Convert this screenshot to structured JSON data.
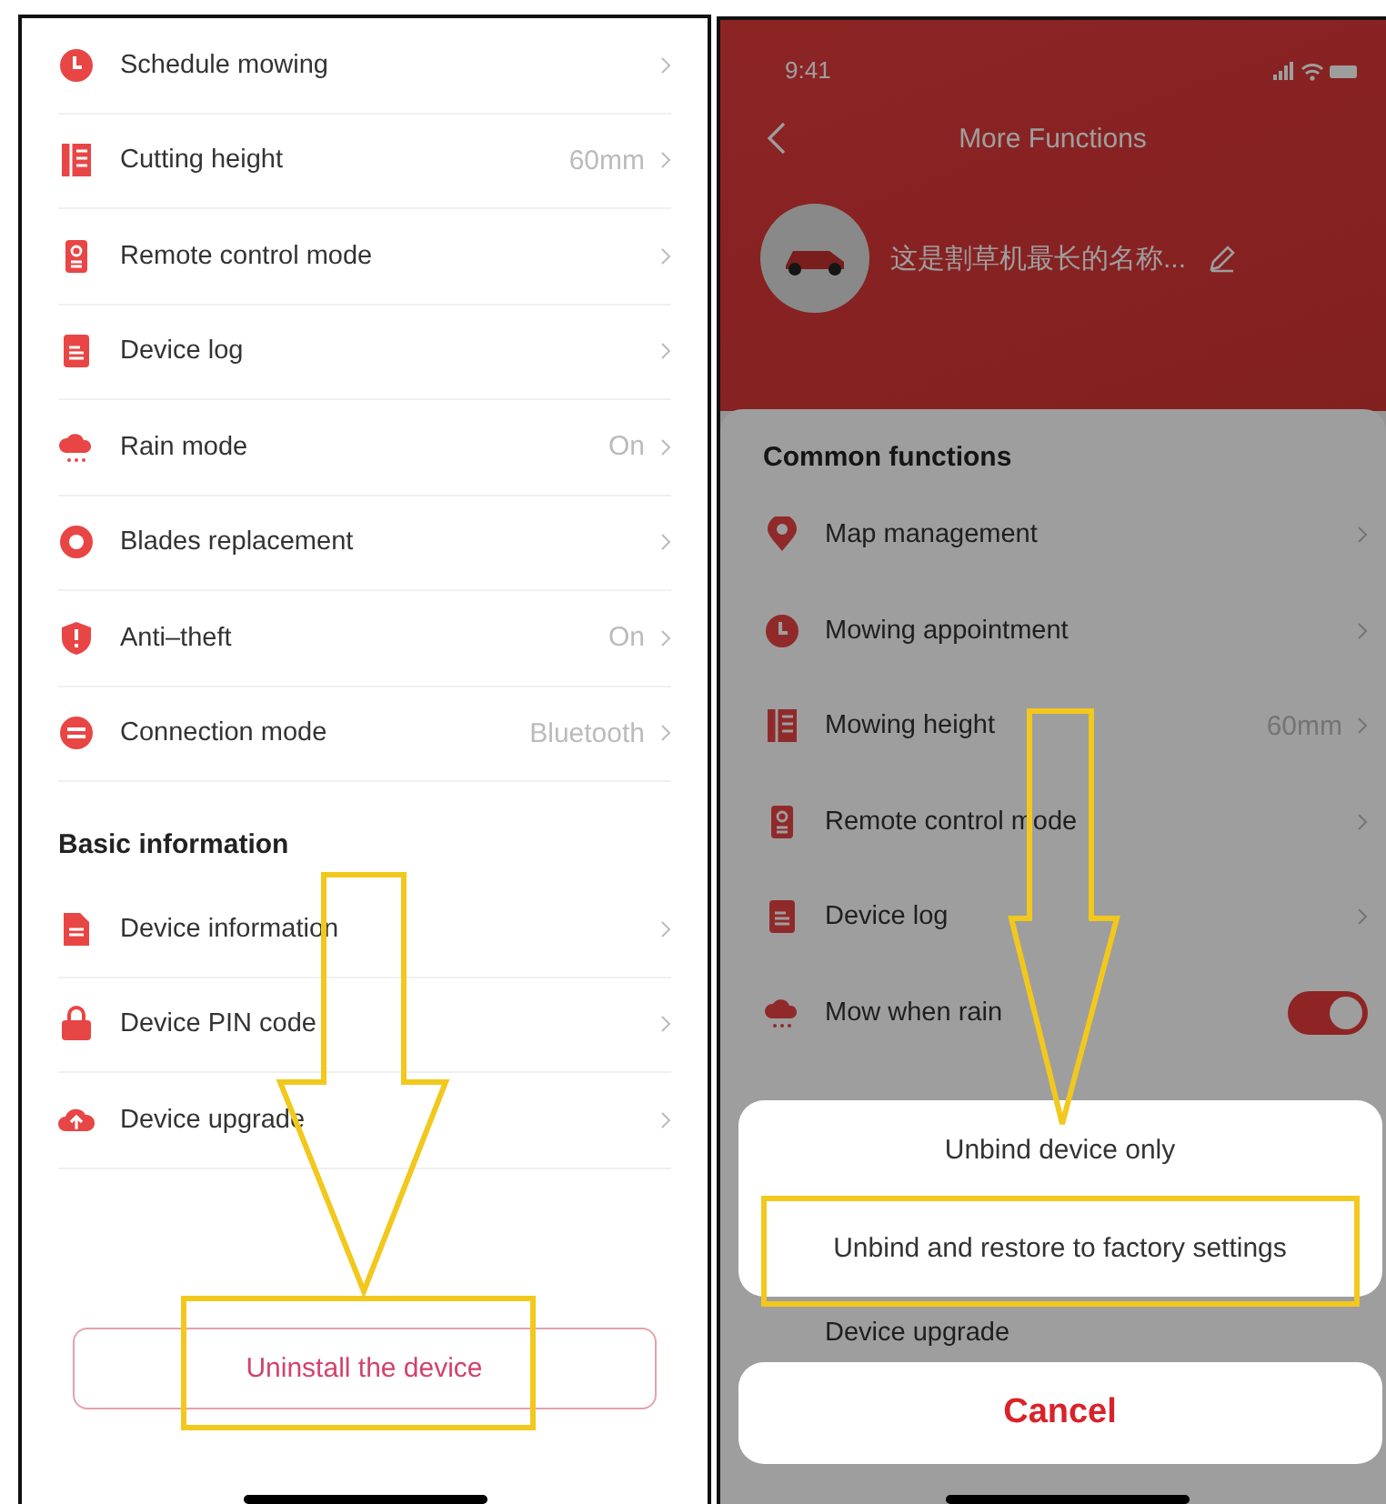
{
  "left_screen": {
    "items": [
      {
        "label": "Schedule mowing",
        "value": ""
      },
      {
        "label": "Cutting height",
        "value": "60mm"
      },
      {
        "label": "Remote control mode",
        "value": ""
      },
      {
        "label": "Device log",
        "value": ""
      },
      {
        "label": "Rain mode",
        "value": "On"
      },
      {
        "label": "Blades replacement",
        "value": ""
      },
      {
        "label": "Anti–theft",
        "value": "On"
      },
      {
        "label": "Connection mode",
        "value": "Bluetooth"
      }
    ],
    "basic_section": {
      "title": "Basic information",
      "items": [
        {
          "label": "Device information"
        },
        {
          "label": "Device PIN code"
        },
        {
          "label": "Device upgrade"
        }
      ]
    },
    "uninstall_button": "Uninstall the device"
  },
  "right_screen": {
    "status_bar": {
      "time": "9:41"
    },
    "title": "More Functions",
    "device_name": "这是割草机最长的名称...",
    "section_title": "Common functions",
    "items": [
      {
        "kind": "link",
        "label": "Map management",
        "value": ""
      },
      {
        "kind": "link",
        "label": "Mowing appointment",
        "value": ""
      },
      {
        "kind": "link",
        "label": "Mowing height",
        "value": "60mm"
      },
      {
        "kind": "link",
        "label": "Remote control mode",
        "value": ""
      },
      {
        "kind": "link",
        "label": "Device log",
        "value": ""
      },
      {
        "kind": "toggle",
        "label": "Mow when rain",
        "on": true
      }
    ],
    "partly_hidden_item": "Device upgrade",
    "action_sheet": {
      "options": [
        "Unbind device only",
        "Unbind and restore to factory settings"
      ],
      "cancel": "Cancel"
    }
  }
}
